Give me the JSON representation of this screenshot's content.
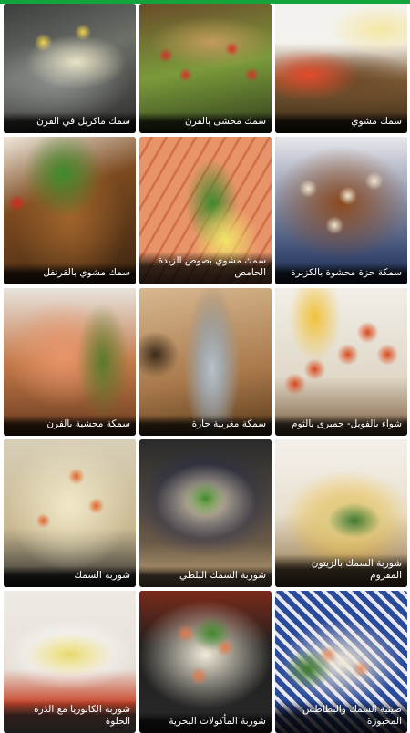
{
  "accent_color": "#13a53b",
  "recipes": [
    {
      "title": "سمك ماكريل في الفرن",
      "photo": "mackerel-baked-with-lemon"
    },
    {
      "title": "سمك محشى بالفرن",
      "photo": "stuffed-fish-with-tomatoes"
    },
    {
      "title": "سمك مشوي",
      "photo": "grilled-fish-with-tomatoes"
    },
    {
      "title": "سمك مشوي بالقرنفل",
      "photo": "grilled-fish-with-herbs"
    },
    {
      "title": "سمك مشوي بصوص الزبدة الحامض",
      "photo": "grilled-salmon-with-lemon"
    },
    {
      "title": "سمكة حزة محشوة بالكزبرة",
      "photo": "fish-stew-in-bowl"
    },
    {
      "title": "سمكة محشية بالفرن",
      "photo": "stuffed-salmon-fillet"
    },
    {
      "title": "سمكة مغربية حارة",
      "photo": "whole-fish-on-board"
    },
    {
      "title": "شواء بالفويل- جمبرى بالثوم",
      "photo": "garlic-shrimp-skewers"
    },
    {
      "title": "شوربة السمك",
      "photo": "fish-soup-with-shrimp"
    },
    {
      "title": "شوربة السمك البلطي",
      "photo": "tilapia-soup-bowl"
    },
    {
      "title": "شوربة السمك بالزيتون المفروم",
      "photo": "fish-soup-with-olives"
    },
    {
      "title": "شوربة الكابوريا مع الذرة الحلوة",
      "photo": "crab-corn-soup"
    },
    {
      "title": "شوربة المأكولات البحرية",
      "photo": "seafood-chowder"
    },
    {
      "title": "صينية السمك والبطاطس المخبوزة",
      "photo": "baked-fish-potato-tray"
    }
  ]
}
